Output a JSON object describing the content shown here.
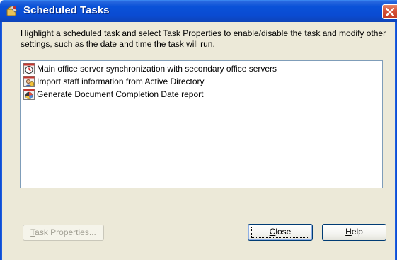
{
  "window": {
    "title": "Scheduled Tasks",
    "icon": "scheduled-tasks-icon",
    "close_glyph": "close-icon"
  },
  "instructions": "Highlight a scheduled task and select Task Properties to enable/disable the task and modify other settings, such as the date and time the task will run.",
  "tasks": [
    {
      "label": "Main office server synchronization with secondary office servers",
      "icon": "clock-icon"
    },
    {
      "label": "Import staff information from Active Directory",
      "icon": "staff-import-icon"
    },
    {
      "label": "Generate Document Completion Date report",
      "icon": "report-icon"
    }
  ],
  "buttons": {
    "task_properties": {
      "mnemonic": "T",
      "rest": "ask Properties...",
      "enabled": false
    },
    "close": {
      "mnemonic": "C",
      "rest": "lose",
      "enabled": true
    },
    "help": {
      "mnemonic": "H",
      "rest": "elp",
      "enabled": true
    }
  },
  "colors": {
    "titlebar": "#0a4bd2",
    "client_bg": "#ece9d8",
    "close_button": "#d6533a",
    "list_border": "#7f9db9",
    "button_border": "#003c74"
  }
}
